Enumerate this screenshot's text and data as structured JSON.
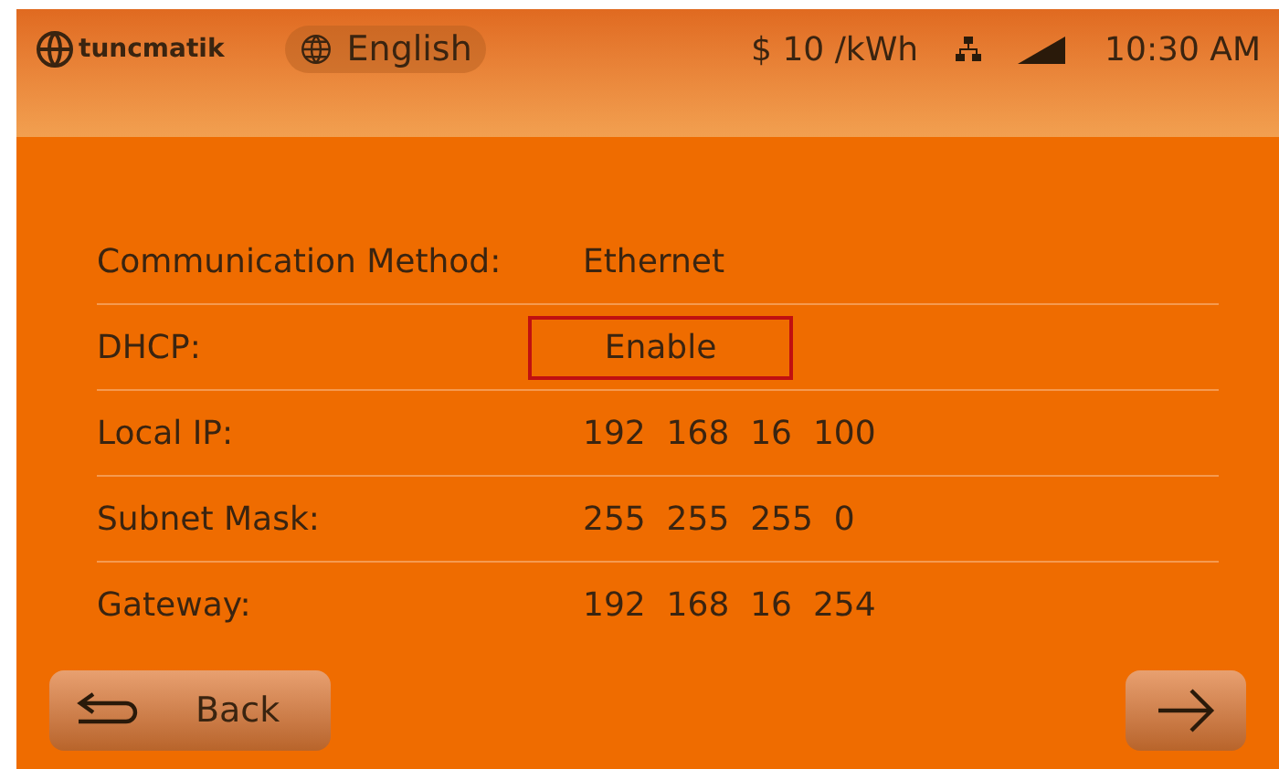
{
  "header": {
    "logo": "tuncmatik",
    "language": "English",
    "price": "$ 10 /kWh",
    "time": "10:30 AM"
  },
  "settings": [
    {
      "label": "Communication Method:",
      "value": "Ethernet",
      "selected": false
    },
    {
      "label": "DHCP:",
      "value": "Enable",
      "selected": true
    },
    {
      "label": "Local IP:",
      "value": "192  168  16  100",
      "selected": false
    },
    {
      "label": "Subnet Mask:",
      "value": "255  255  255  0",
      "selected": false
    },
    {
      "label": "Gateway:",
      "value": "192  168  16  254",
      "selected": false
    }
  ],
  "footer": {
    "back": "Back"
  }
}
